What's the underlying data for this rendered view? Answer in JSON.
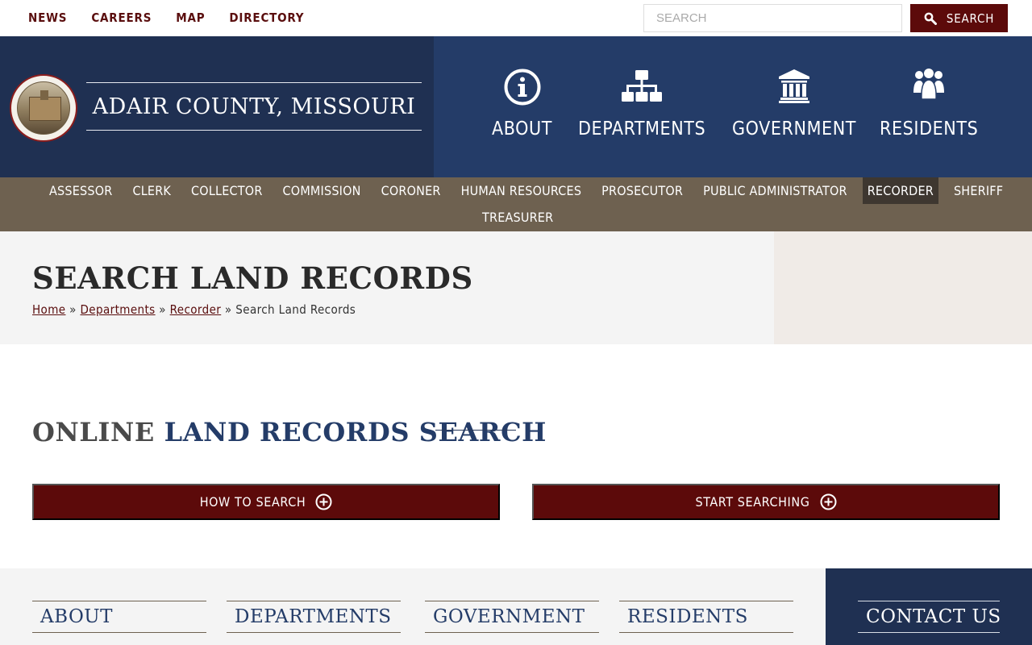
{
  "utility": {
    "links": [
      "NEWS",
      "CAREERS",
      "MAP",
      "DIRECTORY"
    ],
    "search_placeholder": "SEARCH",
    "search_button": "SEARCH"
  },
  "header": {
    "site_title": "ADAIR COUNTY, MISSOURI",
    "main_nav": [
      {
        "label": "ABOUT",
        "icon": "info-circle-icon"
      },
      {
        "label": "DEPARTMENTS",
        "icon": "org-chart-icon"
      },
      {
        "label": "GOVERNMENT",
        "icon": "courthouse-icon"
      },
      {
        "label": "RESIDENTS",
        "icon": "people-icon"
      }
    ]
  },
  "dept_nav": {
    "row1": [
      "ASSESSOR",
      "CLERK",
      "COLLECTOR",
      "COMMISSION",
      "CORONER",
      "HUMAN RESOURCES",
      "PROSECUTOR",
      "PUBLIC ADMINISTRATOR",
      "RECORDER",
      "SHERIFF"
    ],
    "row2": [
      "TREASURER"
    ],
    "active": "RECORDER"
  },
  "page": {
    "title": "SEARCH LAND RECORDS",
    "breadcrumb": {
      "home": "Home",
      "departments": "Departments",
      "recorder": "Recorder",
      "current": "Search Land Records",
      "separator": "»"
    }
  },
  "content": {
    "section_title_part1": "ONLINE",
    "section_title_part2": "LAND RECORDS SEARCH",
    "accordions": [
      "HOW TO SEARCH",
      "START SEARCHING"
    ]
  },
  "footer": {
    "columns": [
      "ABOUT",
      "DEPARTMENTS",
      "GOVERNMENT",
      "RESIDENTS"
    ],
    "contact": "CONTACT US"
  },
  "colors": {
    "navy": "#1f3052",
    "blue": "#243c68",
    "maroon": "#5c0a0a",
    "taupe": "#6e6150"
  }
}
